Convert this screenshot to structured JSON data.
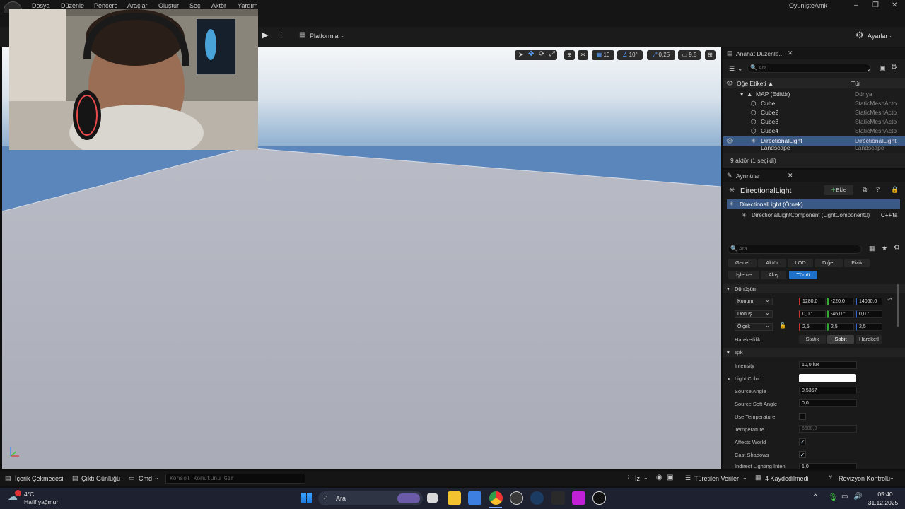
{
  "menu": {
    "items": [
      "Dosya",
      "Düzenle",
      "Pencere",
      "Araçlar",
      "Oluştur",
      "Seç",
      "Aktör",
      "Yardım"
    ],
    "project_name": "OyunİşteAmk"
  },
  "toolbar": {
    "platforms_label": "Platformlar",
    "settings_label": "Ayarlar"
  },
  "viewport_toolbar": {
    "grid_snap": "10",
    "rotation_snap": "10°",
    "scale_snap": "0,25",
    "camera_speed": "9,5"
  },
  "outliner": {
    "tab_title": "Anahat Düzenle...",
    "search_placeholder": "Ara...",
    "col_label": "Öğe Etiketi ▲",
    "col_type": "Tür",
    "rows": [
      {
        "label": "MAP (Editör)",
        "type": "Dünya"
      },
      {
        "label": "Cube",
        "type": "StaticMeshActo"
      },
      {
        "label": "Cube2",
        "type": "StaticMeshActo"
      },
      {
        "label": "Cube3",
        "type": "StaticMeshActo"
      },
      {
        "label": "Cube4",
        "type": "StaticMeshActo"
      },
      {
        "label": "DirectionalLight",
        "type": "DirectionalLight"
      },
      {
        "label": "Landscape",
        "type": "Landscape"
      }
    ],
    "footer": "9 aktör (1 seçildi)"
  },
  "details": {
    "tab_title": "Ayrıntılar",
    "actor_name": "DirectionalLight",
    "add_label": "Ekle",
    "instance_label": "DirectionalLight (Örnek)",
    "component_label": "DirectionalLightComponent (LightComponent0)",
    "component_suffix": "C++'ta",
    "search_placeholder": "Ara",
    "filters_row1": [
      "Genel",
      "Aktör",
      "LOD",
      "Diğer",
      "Fizik"
    ],
    "filters_row2": [
      "İşleme",
      "Akış",
      "Tümü"
    ],
    "section_transform": "Dönüşüm",
    "location_label": "Konum",
    "location": [
      "1280,0",
      "-220,0",
      "14060,0"
    ],
    "rotation_label": "Dönüş",
    "rotation": [
      "0,0 °",
      "-46,0 °",
      "0,0 °"
    ],
    "scale_label": "Ölçek",
    "scale": [
      "2,5",
      "2,5",
      "2,5"
    ],
    "mobility_label": "Hareketlilik",
    "mobility_options": [
      "Statik",
      "Sabit",
      "Hareketl"
    ],
    "section_light": "Işık",
    "intensity_label": "Intensity",
    "intensity": "10,0 lux",
    "light_color_label": "Light Color",
    "light_color": "#ffffff",
    "source_angle_label": "Source Angle",
    "source_angle": "0,5357",
    "source_soft_angle_label": "Source Soft Angle",
    "source_soft_angle": "0,0",
    "use_temperature_label": "Use Temperature",
    "temperature_label": "Temperature",
    "temperature": "6500,0",
    "affects_world_label": "Affects World",
    "cast_shadows_label": "Cast Shadows",
    "indirect_label": "Indirect Lighting Inten",
    "indirect": "1,0"
  },
  "statusbar": {
    "content_drawer": "İçerik Çekmecesi",
    "output_log": "Çıktı Günlüğü",
    "cmd": "Cmd",
    "console_placeholder": "Konsol Komutunu Gir",
    "trace": "İz",
    "derived_data": "Türetilen Veriler",
    "unsaved": "4 Kaydedilmedi",
    "revision": "Revizyon Kontrolü"
  },
  "taskbar": {
    "weather_temp": "4°C",
    "weather_desc": "Hafif yağmur",
    "weather_badge": "1",
    "search_label": "Ara",
    "time": "05:40",
    "date": "31.12.2025"
  }
}
